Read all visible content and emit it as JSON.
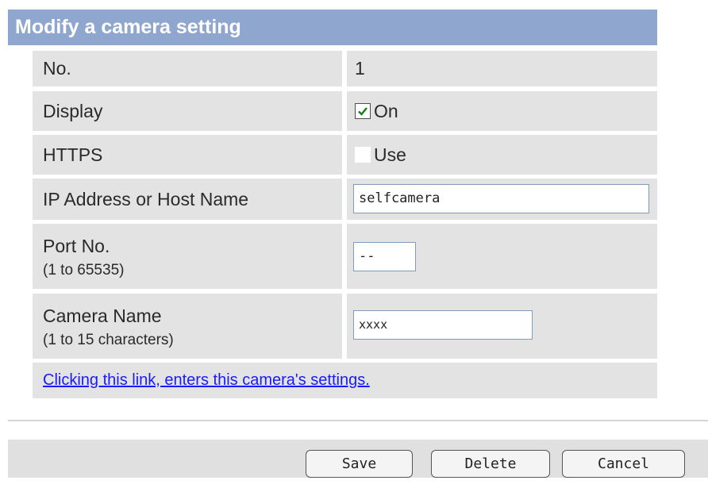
{
  "title": "Modify a camera setting",
  "rows": {
    "number": {
      "label": "No.",
      "value": "1"
    },
    "display": {
      "label": "Display",
      "checkbox_label": "On",
      "checked": true
    },
    "https": {
      "label": "HTTPS",
      "checkbox_label": "Use",
      "checked": false
    },
    "host": {
      "label": "IP Address or Host Name",
      "value": "selfcamera"
    },
    "port": {
      "label": "Port No.",
      "hint": "(1 to 65535)",
      "value": "--"
    },
    "camera_name": {
      "label": "Camera Name",
      "hint": "(1 to 15 characters)",
      "value": "xxxx"
    }
  },
  "link_text": "Clicking this link, enters this camera's settings.",
  "buttons": {
    "save": "Save",
    "delete": "Delete",
    "cancel": "Cancel"
  },
  "colors": {
    "title_bar": "#8fa6cf",
    "row_bg": "#e3e3e3",
    "link": "#1a1aff",
    "footer_bg": "#e0e0e0"
  },
  "icons": {
    "checked": "checkmark-icon"
  }
}
